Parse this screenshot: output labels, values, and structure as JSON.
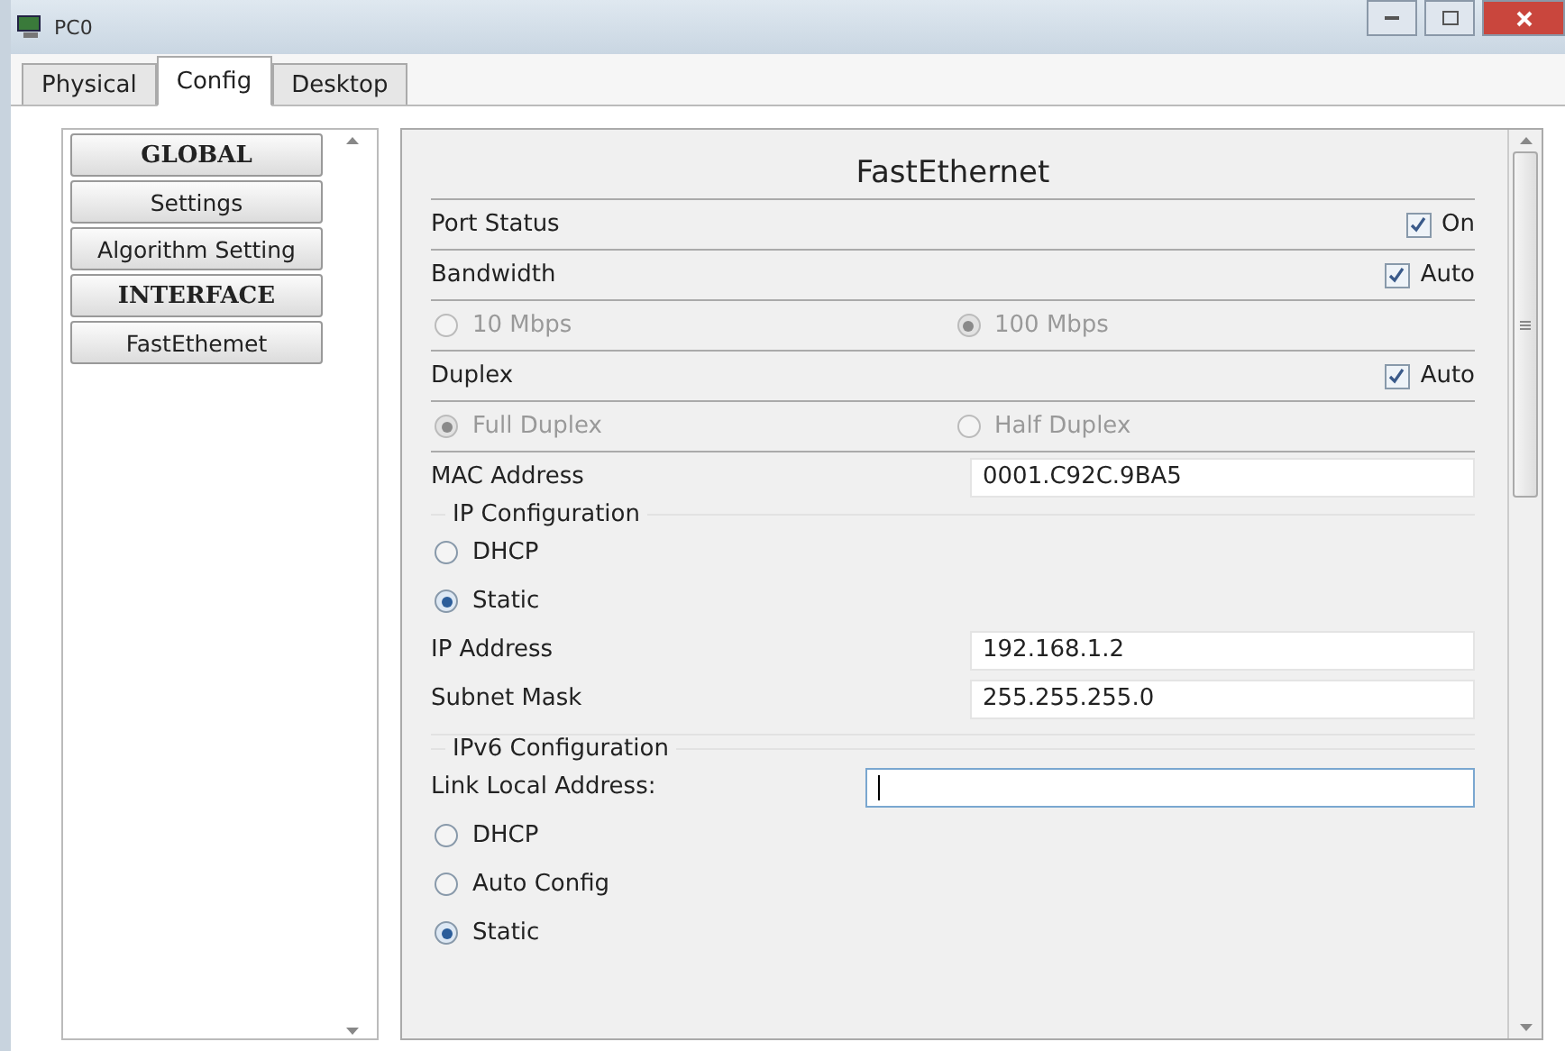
{
  "window": {
    "title": "PC0"
  },
  "tabs": [
    {
      "label": "Physical",
      "selected": false
    },
    {
      "label": "Config",
      "selected": true
    },
    {
      "label": "Desktop",
      "selected": false
    }
  ],
  "sidebar": {
    "items": [
      {
        "label": "GLOBAL",
        "kind": "header"
      },
      {
        "label": "Settings",
        "kind": "button"
      },
      {
        "label": "Algorithm Setting",
        "kind": "button"
      },
      {
        "label": "INTERFACE",
        "kind": "header"
      },
      {
        "label": "FastEthemet",
        "kind": "button"
      }
    ]
  },
  "panel": {
    "title": "FastEthernet",
    "port_status": {
      "label": "Port Status",
      "check_label": "On",
      "checked": true
    },
    "bandwidth": {
      "label": "Bandwidth",
      "check_label": "Auto",
      "checked": true,
      "options": [
        {
          "label": "10 Mbps",
          "selected": false,
          "disabled": true
        },
        {
          "label": "100 Mbps",
          "selected": true,
          "disabled": true
        }
      ]
    },
    "duplex": {
      "label": "Duplex",
      "check_label": "Auto",
      "checked": true,
      "options": [
        {
          "label": "Full Duplex",
          "selected": true,
          "disabled": true
        },
        {
          "label": "Half Duplex",
          "selected": false,
          "disabled": true
        }
      ]
    },
    "mac": {
      "label": "MAC Address",
      "value": "0001.C92C.9BA5"
    },
    "ip_config": {
      "legend": "IP Configuration",
      "modes": [
        {
          "label": "DHCP",
          "selected": false
        },
        {
          "label": "Static",
          "selected": true
        }
      ],
      "fields": [
        {
          "label": "IP Address",
          "value": "192.168.1.2"
        },
        {
          "label": "Subnet Mask",
          "value": "255.255.255.0"
        }
      ]
    },
    "ipv6_config": {
      "legend": "IPv6 Configuration",
      "link_local_label": "Link Local Address:",
      "modes": [
        {
          "label": "DHCP",
          "selected": false
        },
        {
          "label": "Auto Config",
          "selected": false
        },
        {
          "label": "Static",
          "selected": true
        }
      ]
    }
  }
}
